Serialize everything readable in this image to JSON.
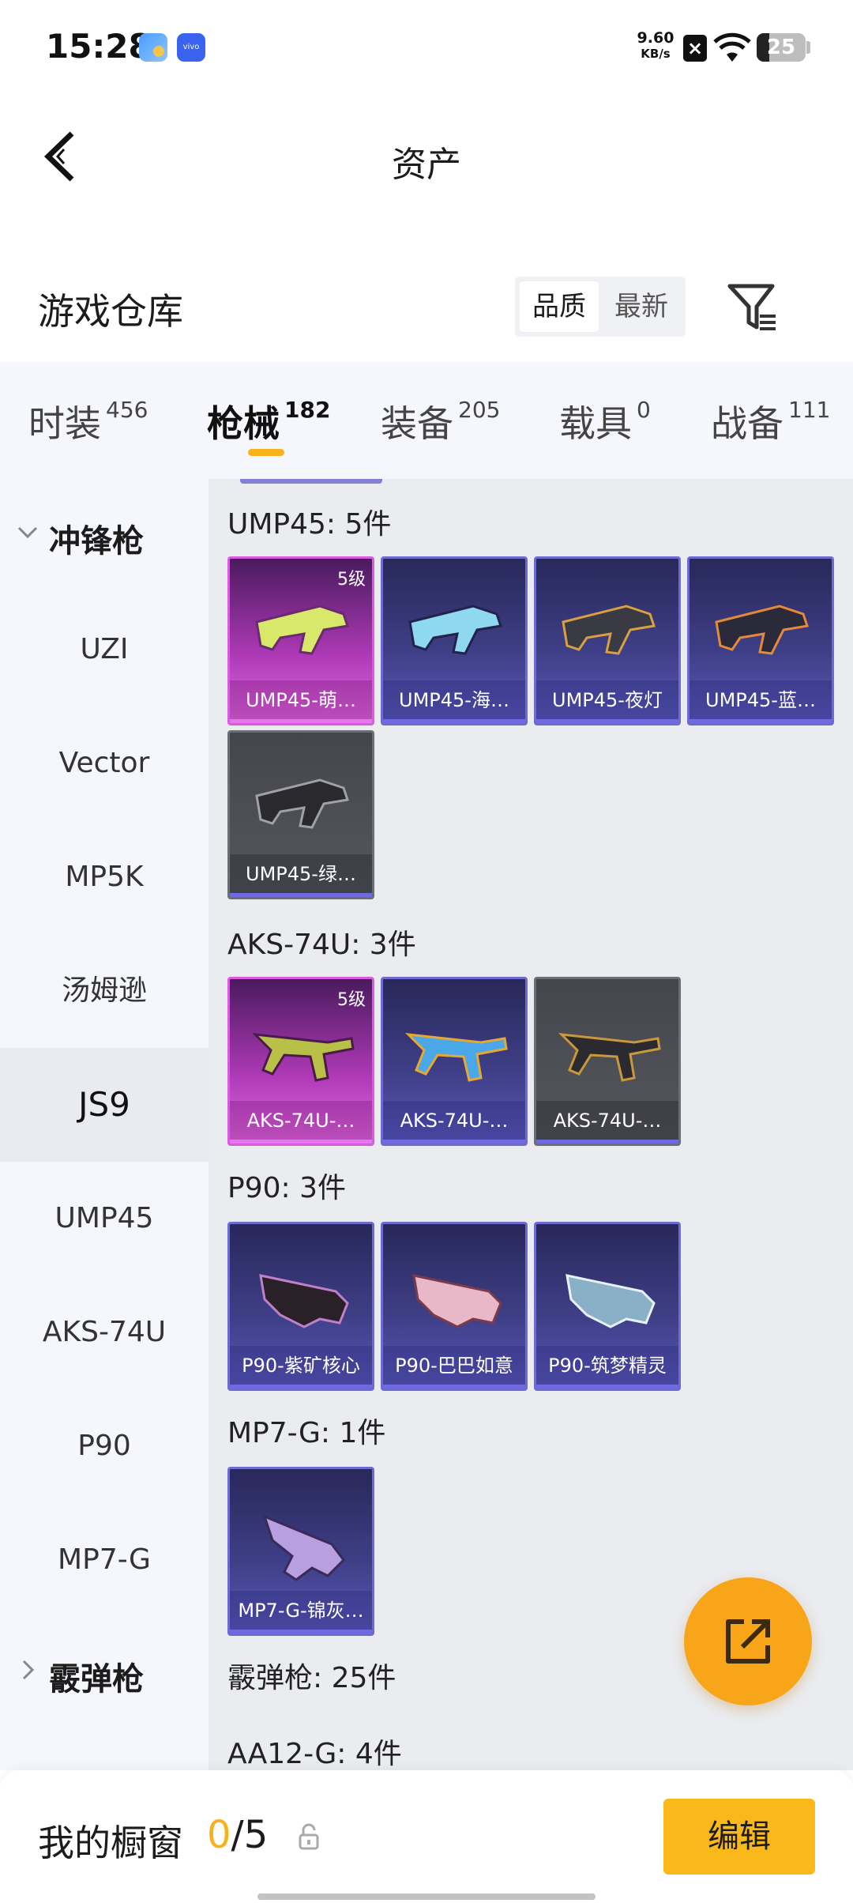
{
  "status_bar": {
    "time": "15:28",
    "net_speed_value": "9.60",
    "net_speed_unit": "KB/s",
    "battery": "25",
    "battery_level": 0.25
  },
  "header": {
    "title": "资产",
    "back_icon": "back-arrow-icon"
  },
  "warehouse": {
    "title": "游戏仓库",
    "sort_options": [
      "品质",
      "最新"
    ],
    "sort_selected": "品质",
    "filter_icon": "filter-icon"
  },
  "tabs": [
    {
      "label": "时装",
      "count": "456"
    },
    {
      "label": "枪械",
      "count": "182",
      "active": true
    },
    {
      "label": "装备",
      "count": "205"
    },
    {
      "label": "载具",
      "count": "0"
    },
    {
      "label": "战备",
      "count": "111"
    }
  ],
  "sidebar": {
    "group_expanded": "冲锋枪",
    "items": [
      "UZI",
      "Vector",
      "MP5K",
      "汤姆逊",
      "JS9",
      "UMP45",
      "AKS-74U",
      "P90",
      "MP7-G"
    ],
    "active_item": "JS9",
    "group_collapsed": "霰弹枪"
  },
  "sections": [
    {
      "title": "UMP45: 5件",
      "items": [
        {
          "name": "UMP45-萌…",
          "rarity": "gold",
          "level": "5级"
        },
        {
          "name": "UMP45-海…",
          "rarity": "purple"
        },
        {
          "name": "UMP45-夜灯",
          "rarity": "purple"
        },
        {
          "name": "UMP45-蓝…",
          "rarity": "purple"
        },
        {
          "name": "UMP45-绿…",
          "rarity": "gray"
        }
      ]
    },
    {
      "title": "AKS-74U: 3件",
      "items": [
        {
          "name": "AKS-74U-…",
          "rarity": "gold",
          "level": "5级"
        },
        {
          "name": "AKS-74U-…",
          "rarity": "purple"
        },
        {
          "name": "AKS-74U-…",
          "rarity": "gray"
        }
      ]
    },
    {
      "title": "P90: 3件",
      "items": [
        {
          "name": "P90-紫矿核心",
          "rarity": "purple"
        },
        {
          "name": "P90-巴巴如意",
          "rarity": "purple"
        },
        {
          "name": "P90-筑梦精灵",
          "rarity": "purple"
        }
      ]
    },
    {
      "title": "MP7-G: 1件",
      "items": [
        {
          "name": "MP7-G-锦灰…",
          "rarity": "purple"
        }
      ]
    }
  ],
  "shotgun_title": "霰弹枪: 25件",
  "shotgun_sub_title": "AA12-G: 4件",
  "showcase": {
    "label": "我的橱窗",
    "used": "0",
    "total": "/5",
    "edit_label": "编辑"
  },
  "colors": {
    "accent": "#fbb81a",
    "gold_rarity": "#d85be0",
    "purple_rarity": "#6d6ad0",
    "gray_rarity": "#6c6e76"
  }
}
